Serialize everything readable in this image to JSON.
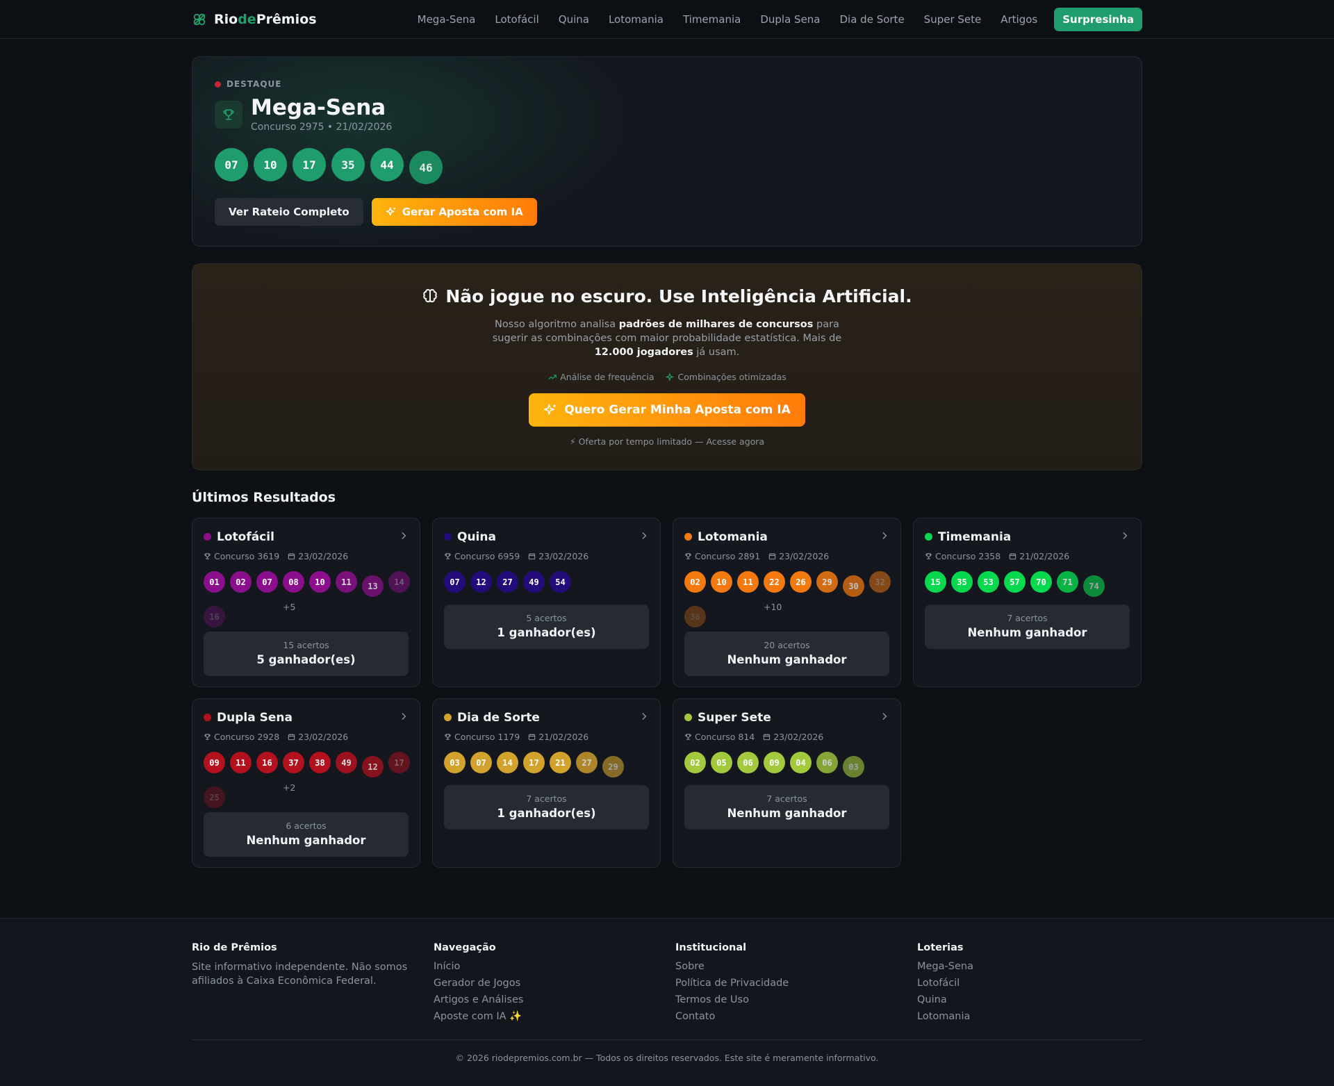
{
  "brand": {
    "part1": "Rio",
    "part2": "de",
    "part3": "Prêmios"
  },
  "nav": {
    "items": [
      "Mega-Sena",
      "Lotofácil",
      "Quina",
      "Lotomania",
      "Timemania",
      "Dupla Sena",
      "Dia de Sorte",
      "Super Sete",
      "Artigos"
    ],
    "cta": "Surpresinha"
  },
  "highlight": {
    "tag": "DESTAQUE",
    "title": "Mega-Sena",
    "subtitle": "Concurso 2975 • 21/02/2026",
    "numbers": [
      "07",
      "10",
      "17",
      "35",
      "44",
      "46"
    ],
    "btn_rateio": "Ver Rateio Completo",
    "btn_ia": "Gerar Aposta com IA"
  },
  "ai": {
    "title": "Não jogue no escuro. Use Inteligência Artificial.",
    "text_1": "Nosso algoritmo analisa ",
    "text_b1": "padrões de milhares de concursos",
    "text_2": " para sugerir as combinações com maior probabilidade estatística. Mais de ",
    "text_b2": "12.000 jogadores",
    "text_3": " já usam.",
    "feat_1": "Análise de frequência",
    "feat_2": "Combinações otimizadas",
    "button": "Quero Gerar Minha Aposta com IA",
    "note": "⚡ Oferta por tempo limitado — Acesse agora"
  },
  "results": {
    "title": "Últimos Resultados",
    "cards": [
      {
        "name": "Lotofácil",
        "color": "#8b0f8c",
        "concurso": "Concurso 3619",
        "date": "23/02/2026",
        "balls": [
          "01",
          "02",
          "07",
          "08",
          "10",
          "11",
          "13",
          "14",
          "16"
        ],
        "more": "+5",
        "prize_label": "15 acertos",
        "prize_value": "5 ganhador(es)"
      },
      {
        "name": "Quina",
        "color": "#230c7a",
        "concurso": "Concurso 6959",
        "date": "23/02/2026",
        "balls": [
          "07",
          "12",
          "27",
          "49",
          "54"
        ],
        "more": "",
        "prize_label": "5 acertos",
        "prize_value": "1 ganhador(es)"
      },
      {
        "name": "Lotomania",
        "color": "#f47a10",
        "concurso": "Concurso 2891",
        "date": "23/02/2026",
        "balls": [
          "02",
          "10",
          "11",
          "22",
          "26",
          "29",
          "30",
          "32",
          "36"
        ],
        "more": "+10",
        "prize_label": "20 acertos",
        "prize_value": "Nenhum ganhador"
      },
      {
        "name": "Timemania",
        "color": "#07d94e",
        "concurso": "Concurso 2358",
        "date": "21/02/2026",
        "balls": [
          "15",
          "35",
          "53",
          "57",
          "70",
          "71",
          "74"
        ],
        "more": "",
        "prize_label": "7 acertos",
        "prize_value": "Nenhum ganhador"
      },
      {
        "name": "Dupla Sena",
        "color": "#b3111e",
        "concurso": "Concurso 2928",
        "date": "23/02/2026",
        "balls": [
          "09",
          "11",
          "16",
          "37",
          "38",
          "49",
          "12",
          "17",
          "25"
        ],
        "more": "+2",
        "prize_label": "6 acertos",
        "prize_value": "Nenhum ganhador"
      },
      {
        "name": "Dia de Sorte",
        "color": "#d2a22c",
        "concurso": "Concurso 1179",
        "date": "21/02/2026",
        "balls": [
          "03",
          "07",
          "14",
          "17",
          "21",
          "27",
          "29"
        ],
        "more": "",
        "prize_label": "7 acertos",
        "prize_value": "1 ganhador(es)"
      },
      {
        "name": "Super Sete",
        "color": "#a3c93c",
        "concurso": "Concurso 814",
        "date": "23/02/2026",
        "balls": [
          "02",
          "05",
          "06",
          "09",
          "04",
          "06",
          "03"
        ],
        "more": "",
        "prize_label": "7 acertos",
        "prize_value": "Nenhum ganhador"
      }
    ]
  },
  "footer": {
    "about_title": "Rio de Prêmios",
    "about_text": "Site informativo independente. Não somos afiliados à Caixa Econômica Federal.",
    "nav_title": "Navegação",
    "nav_links": [
      "Início",
      "Gerador de Jogos",
      "Artigos e Análises",
      "Aposte com IA ✨"
    ],
    "inst_title": "Institucional",
    "inst_links": [
      "Sobre",
      "Política de Privacidade",
      "Termos de Uso",
      "Contato"
    ],
    "lot_title": "Loterias",
    "lot_links": [
      "Mega-Sena",
      "Lotofácil",
      "Quina",
      "Lotomania"
    ],
    "copyright": "© 2026 riodepremios.com.br — Todos os direitos reservados. Este site é meramente informativo."
  }
}
